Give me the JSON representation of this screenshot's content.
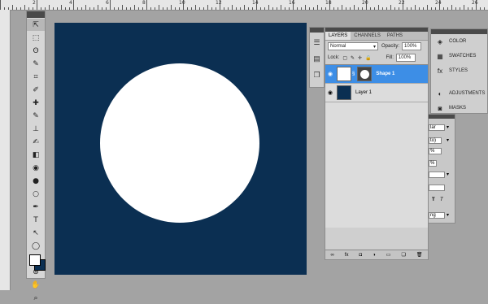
{
  "ruler": {
    "numbers": [
      "2",
      "4",
      "6",
      "8",
      "10",
      "12",
      "14",
      "16",
      "18",
      "20",
      "22",
      "24",
      "26"
    ]
  },
  "toolbar": {
    "tools": [
      "move-tool-icon",
      "marquee-tool-icon",
      "lasso-tool-icon",
      "quick-select-tool-icon",
      "crop-tool-icon",
      "eyedropper-tool-icon",
      "healing-brush-icon",
      "brush-tool-icon",
      "clone-stamp-icon",
      "history-brush-icon",
      "eraser-tool-icon",
      "paint-bucket-icon",
      "blur-tool-icon",
      "dodge-tool-icon",
      "pen-tool-icon",
      "type-tool-icon",
      "path-select-icon",
      "shape-tool-icon",
      "3d-rotate-icon",
      "3d-orbit-icon",
      "hand-tool-icon",
      "zoom-tool-icon"
    ],
    "glyphs": [
      "⇱",
      "⬚",
      "ʘ",
      "✎",
      "⌗",
      "✐",
      "✚",
      "✎",
      "⊥",
      "✍",
      "◧",
      "◉",
      "●",
      "○",
      "✒",
      "T",
      "↖",
      "◯",
      "⟳",
      "⊛",
      "✋",
      "⌕"
    ],
    "foreground": "#ffffff",
    "background": "#0b2f52"
  },
  "canvas": {
    "background": "#0b2f52",
    "shape_color": "#ffffff"
  },
  "layers_panel": {
    "tabs": [
      "LAYERS",
      "CHANNELS",
      "PATHS"
    ],
    "blend_mode": "Normal",
    "opacity_label": "Opacity:",
    "opacity_value": "100%",
    "lock_label": "Lock:",
    "fill_label": "Fill:",
    "fill_value": "100%",
    "layers": [
      {
        "name": "Shape 1",
        "selected": true
      },
      {
        "name": "Layer 1",
        "selected": false
      }
    ]
  },
  "side_panels": {
    "items": [
      "COLOR",
      "SWATCHES",
      "STYLES",
      "ADJUSTMENTS",
      "MASKS"
    ]
  },
  "back_panel": {
    "field1": "lar",
    "field2": "to)",
    "field3": "%",
    "field4": "%",
    "field5": "ng"
  }
}
